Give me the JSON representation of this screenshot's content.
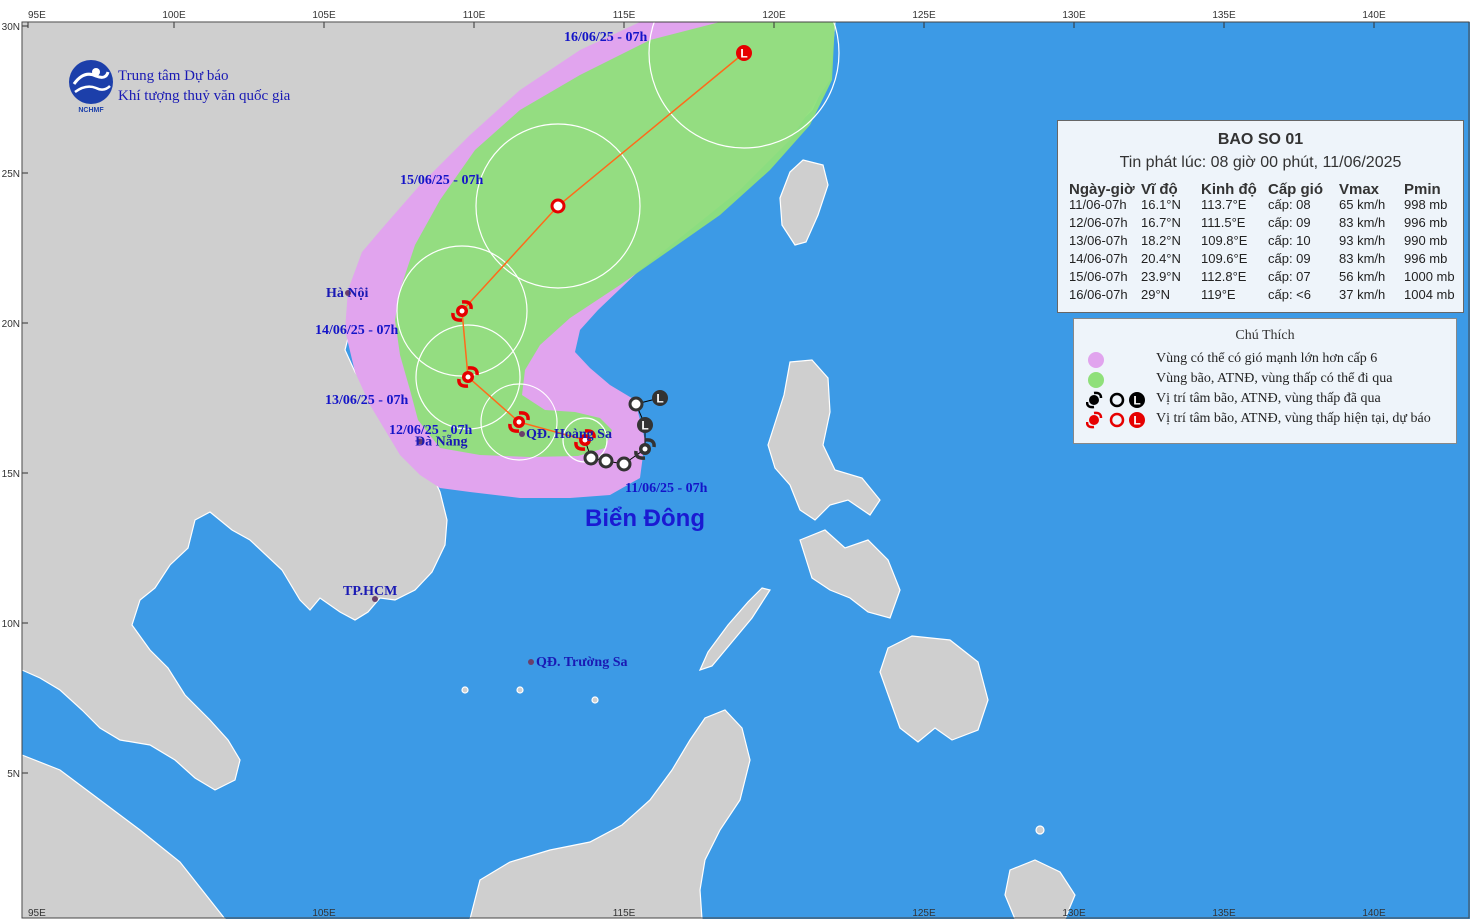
{
  "map": {
    "colors": {
      "sea": "#3c9ae6",
      "land": "#cfcfcf",
      "wind_zone": "#e1a4ee",
      "storm_zone": "#8fe07a",
      "track": "#ff6a1a",
      "current": "#e60000",
      "past": "#000000"
    },
    "lon_ticks_top": [
      "95E",
      "100E",
      "105E",
      "110E",
      "115E",
      "120E",
      "125E",
      "130E",
      "135E",
      "140E"
    ],
    "lon_ticks_bottom": [
      "95E",
      "105E",
      "115E",
      "125E",
      "130E",
      "135E",
      "140E"
    ],
    "lat_ticks": [
      "30N",
      "25N",
      "20N",
      "15N",
      "10N",
      "5N"
    ],
    "sea_label": "Biển Đông",
    "places": [
      {
        "name": "Hà Nội",
        "lat": 21.0,
        "lon": 105.8
      },
      {
        "name": "Đà Nẵng",
        "lat": 16.05,
        "lon": 108.2
      },
      {
        "name": "TP.HCM",
        "lat": 10.8,
        "lon": 106.7
      },
      {
        "name": "QĐ. Hoàng Sa",
        "lat": 16.3,
        "lon": 111.6
      },
      {
        "name": "QĐ. Trường Sa",
        "lat": 8.7,
        "lon": 111.9
      }
    ],
    "track": [
      {
        "label": "11/06/25 - 07h",
        "lat": 16.1,
        "lon": 113.7,
        "symbol": "storm",
        "status": "current"
      },
      {
        "label": "12/06/25 - 07h",
        "lat": 16.7,
        "lon": 111.5,
        "symbol": "storm",
        "status": "forecast"
      },
      {
        "label": "13/06/25 - 07h",
        "lat": 18.2,
        "lon": 109.8,
        "symbol": "storm",
        "status": "forecast"
      },
      {
        "label": "14/06/25 - 07h",
        "lat": 20.4,
        "lon": 109.6,
        "symbol": "storm",
        "status": "forecast"
      },
      {
        "label": "15/06/25 - 07h",
        "lat": 23.9,
        "lon": 112.8,
        "symbol": "depression",
        "status": "forecast"
      },
      {
        "label": "16/06/25 - 07h",
        "lat": 29.0,
        "lon": 119.0,
        "symbol": "low",
        "status": "forecast"
      }
    ],
    "past_positions": [
      {
        "lat": 17.5,
        "lon": 116.2,
        "symbol": "low"
      },
      {
        "lat": 17.3,
        "lon": 115.4,
        "symbol": "depression"
      },
      {
        "lat": 16.6,
        "lon": 115.7,
        "symbol": "low"
      },
      {
        "lat": 15.8,
        "lon": 115.7,
        "symbol": "storm"
      },
      {
        "lat": 15.3,
        "lon": 115.0,
        "symbol": "depression"
      },
      {
        "lat": 15.4,
        "lon": 114.4,
        "symbol": "depression"
      },
      {
        "lat": 15.5,
        "lon": 113.9,
        "symbol": "depression"
      }
    ]
  },
  "agency": {
    "logo_text": "NCHMF",
    "name_line1": "Trung tâm Dự báo",
    "name_line2": "Khí tượng thuỷ văn quốc gia"
  },
  "bulletin": {
    "title": "BAO SO 01",
    "issued": "Tin phát lúc: 08 giờ 00 phút, 11/06/2025",
    "headers": [
      "Ngày-giờ",
      "Vĩ độ",
      "Kinh độ",
      "Cấp gió",
      "Vmax",
      "Pmin"
    ],
    "rows": [
      [
        "11/06-07h",
        "16.1°N",
        "113.7°E",
        "cấp: 08",
        "65 km/h",
        "998 mb"
      ],
      [
        "12/06-07h",
        "16.7°N",
        "111.5°E",
        "cấp: 09",
        "83 km/h",
        "996 mb"
      ],
      [
        "13/06-07h",
        "18.2°N",
        "109.8°E",
        "cấp: 10",
        "93 km/h",
        "990 mb"
      ],
      [
        "14/06-07h",
        "20.4°N",
        "109.6°E",
        "cấp: 09",
        "83 km/h",
        "996 mb"
      ],
      [
        "15/06-07h",
        "23.9°N",
        "112.8°E",
        "cấp: 07",
        "56 km/h",
        "1000 mb"
      ],
      [
        "16/06-07h",
        "29°N",
        "119°E",
        "cấp: <6",
        "37 km/h",
        "1004 mb"
      ]
    ]
  },
  "legend": {
    "title": "Chú Thích",
    "items": [
      {
        "text": "Vùng có thể có gió mạnh lớn hơn cấp 6",
        "type": "wind_zone"
      },
      {
        "text": "Vùng bão, ATNĐ, vùng thấp có thể đi qua",
        "type": "storm_zone"
      },
      {
        "text": "Vị trí tâm bão, ATNĐ, vùng thấp đã qua",
        "type": "past"
      },
      {
        "text": "Vị trí tâm bão, ATNĐ, vùng thấp hiện tại, dự báo",
        "type": "current"
      }
    ]
  }
}
